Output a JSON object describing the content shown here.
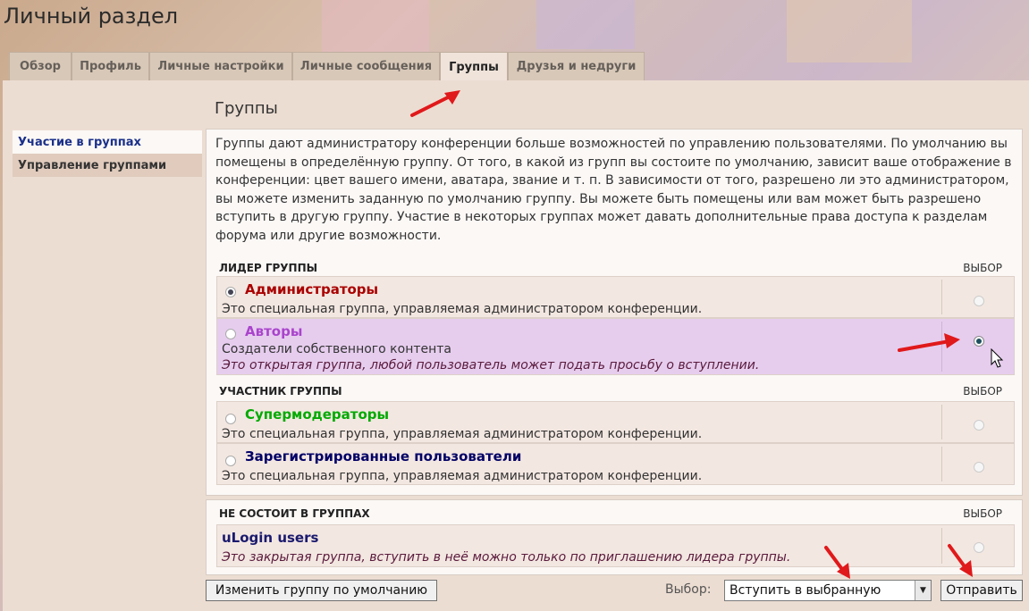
{
  "page": {
    "title": "Личный раздел"
  },
  "tabs": [
    {
      "label": "Обзор"
    },
    {
      "label": "Профиль"
    },
    {
      "label": "Личные настройки"
    },
    {
      "label": "Личные сообщения"
    },
    {
      "label": "Группы",
      "active": true
    },
    {
      "label": "Друзья и недруги"
    }
  ],
  "sidebar": {
    "items": [
      {
        "label": "Участие в группах",
        "active": true
      },
      {
        "label": "Управление группами"
      }
    ]
  },
  "main": {
    "heading": "Группы",
    "intro": "Группы дают администратору конференции больше возможностей по управлению пользователями. По умолчанию вы помещены в определённую группу. От того, в какой из групп вы состоите по умолчанию, зависит ваше отображение в конференции: цвет вашего имени, аватара, звание и т. п. В зависимости от того, разрешено ли это администратором, вы можете изменить заданную по умолчанию группу. Вы можете быть помещены или вам может быть разрешено вступить в другую группу. Участие в некоторых группах может давать дополнительные права доступа к разделам форума или другие возможности.",
    "leader_section": {
      "header": "ЛИДЕР ГРУППЫ",
      "choice_label": "ВЫБОР",
      "groups": [
        {
          "name": "Администраторы",
          "color": "#aa0000",
          "desc": "Это специальная группа, управляемая администратором конференции.",
          "default_selected": true,
          "choice_selected": false
        },
        {
          "name": "Авторы",
          "color": "#aa44cc",
          "desc": "Создатели собственного контента",
          "note": "Это открытая группа, любой пользователь может подать просьбу о вступлении.",
          "default_selected": false,
          "choice_selected": true
        }
      ]
    },
    "member_section": {
      "header": "УЧАСТНИК ГРУППЫ",
      "choice_label": "ВЫБОР",
      "groups": [
        {
          "name": "Супермодераторы",
          "color": "#00aa00",
          "desc": "Это специальная группа, управляемая администратором конференции."
        },
        {
          "name": "Зарегистрированные пользователи",
          "color": "#000066",
          "desc": "Это специальная группа, управляемая администратором конференции."
        }
      ]
    },
    "nonmember_section": {
      "header": "НЕ СОСТОИТ В ГРУППАХ",
      "choice_label": "ВЫБОР",
      "groups": [
        {
          "name": "uLogin users",
          "color": "#1a1a6e",
          "note": "Это закрытая группа, вступить в неё можно только по приглашению лидера группы."
        }
      ]
    }
  },
  "footer": {
    "change_default_button": "Изменить группу по умолчанию",
    "select_label": "Выбор:",
    "select_value": "Вступить в выбранную",
    "submit_button": "Отправить"
  },
  "colors": {
    "accent_link": "#1a2f8a",
    "annotation_arrow": "#e0191b"
  }
}
